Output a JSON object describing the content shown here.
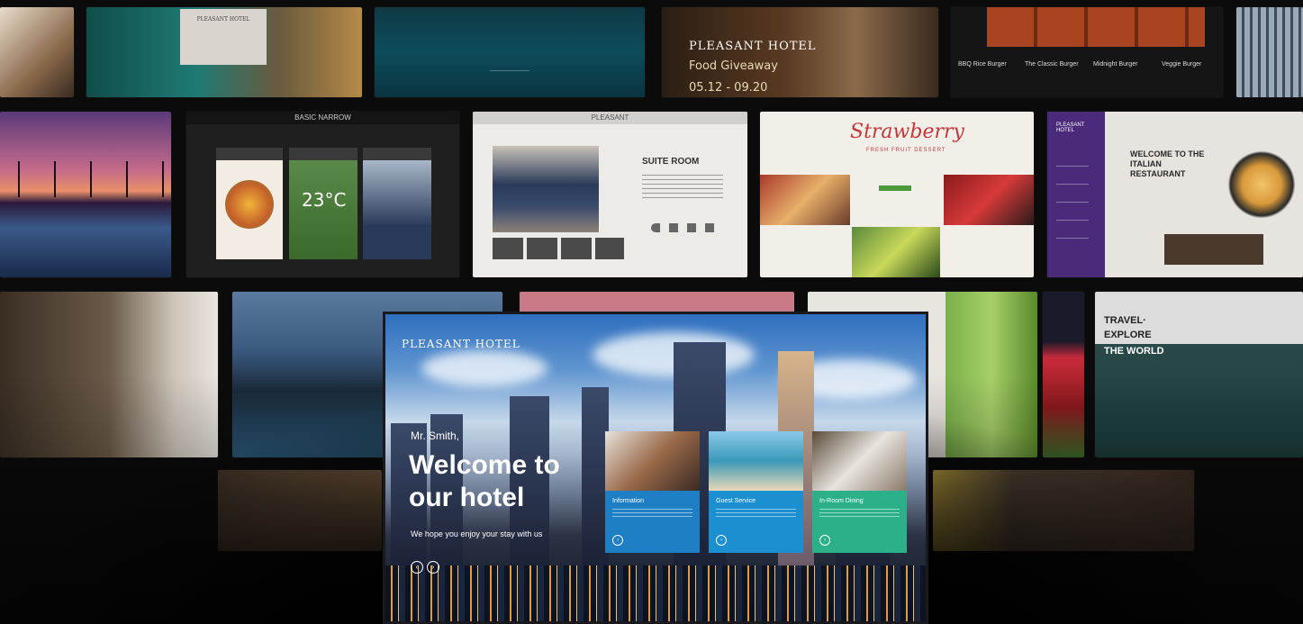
{
  "wall": {
    "row1": {
      "tile_b_label": "PLEASANT HOTEL",
      "tile_d_brand": "PLEASANT HOTEL",
      "tile_d_promo": "Food Giveaway",
      "tile_d_dates": "05.12 - 09.20",
      "tile_e_items": [
        "BBQ Rice Burger",
        "The Classic Burger",
        "Midnight Burger",
        "Veggie Burger"
      ]
    },
    "row2": {
      "basic_banner": "BASIC NARROW",
      "basic_temp": "23°C",
      "suite_banner": "PLEASANT",
      "suite_title": "SUITE ROOM",
      "strawberry_title": "Strawberry",
      "strawberry_sub": "FRESH FRUIT DESSERT",
      "italian_brand": "PLEASANT HOTEL",
      "italian_title": "WELCOME TO THE ITALIAN RESTAURANT"
    },
    "row3": {
      "travel_line1": "TRAVEL·",
      "travel_line2": "EXPLORE",
      "travel_line3": "THE WORLD"
    }
  },
  "tv": {
    "logo": "PLEASANT HOTEL",
    "greeting": "Mr. Smith,",
    "headline": "Welcome to our hotel",
    "subtext": "We hope you enjoy your stay with us",
    "cards": [
      {
        "title": "Information",
        "color": "#1f7fc4"
      },
      {
        "title": "Guest Service",
        "color": "#1b8fd0"
      },
      {
        "title": "In-Room Dining",
        "color": "#2bb08a"
      }
    ]
  },
  "colors": {
    "background": "#0b0b0c",
    "strawberry_red": "#c7373a",
    "italian_purple": "#4a2a7a"
  }
}
